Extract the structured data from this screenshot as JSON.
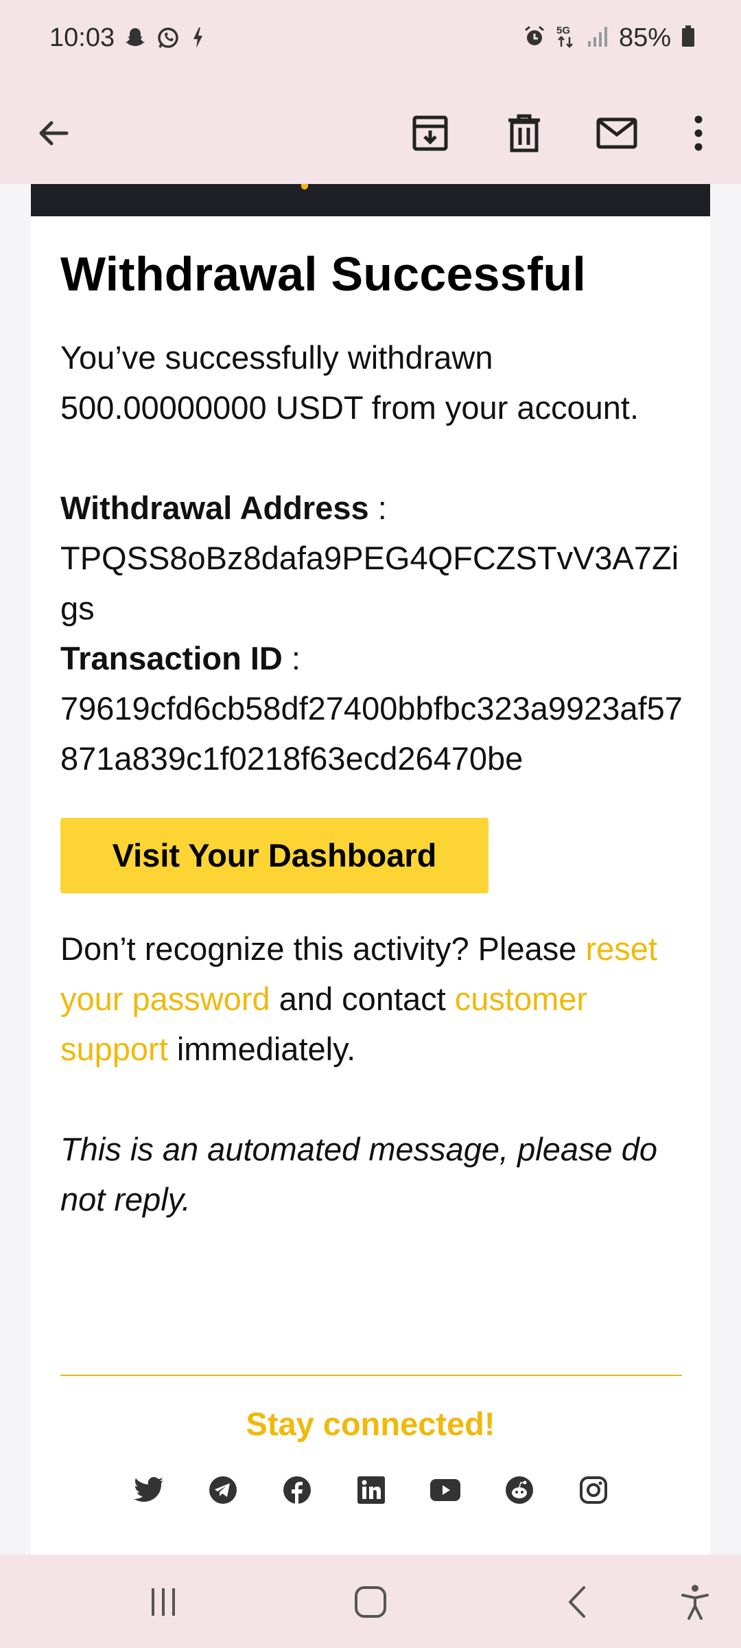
{
  "status_bar": {
    "time": "10:03",
    "battery_percent": "85%",
    "network": "5G",
    "left_icons": [
      "snapchat-icon",
      "whatsapp-icon",
      "charging-bolt-icon"
    ],
    "right_icons": [
      "alarm-icon",
      "5g-data-icon",
      "signal-icon",
      "battery-icon"
    ]
  },
  "app_bar": {
    "icons": [
      "back-arrow-icon",
      "archive-icon",
      "delete-icon",
      "mark-unread-icon",
      "more-vert-icon"
    ]
  },
  "email": {
    "title": "Withdrawal Successful",
    "intro": "You’ve successfully withdrawn 500.00000000 USDT from your account.",
    "address_label": "Withdrawal Address",
    "address_sep": " :",
    "address_value": "TPQSS8oBz8dafa9PEG4QFCZSTvV3A7Zigs",
    "txid_label": "Transaction ID",
    "txid_sep": " :",
    "txid_value": "79619cfd6cb58df27400bbfbc323a9923af57871a839c1f0218f63ecd26470be",
    "cta_label": "Visit Your Dashboard",
    "warning_prefix": "Don’t recognize this activity? Please ",
    "reset_link": "reset your password",
    "warning_mid": " and contact ",
    "support_link": "customer support",
    "warning_suffix": " immediately.",
    "automated_note": "This is an automated message, please do not reply.",
    "stay_connected": "Stay connected!",
    "social_icons": [
      "twitter-icon",
      "telegram-icon",
      "facebook-icon",
      "linkedin-icon",
      "youtube-icon",
      "reddit-icon",
      "instagram-icon"
    ]
  },
  "colors": {
    "accent_yellow": "#f0b90b",
    "button_yellow": "#fcd535",
    "system_bar_bg": "#f4e4e8",
    "banner_dark": "#1e2026"
  },
  "nav_bar": {
    "icons": [
      "recent-apps-icon",
      "home-icon",
      "back-icon",
      "accessibility-icon"
    ]
  }
}
